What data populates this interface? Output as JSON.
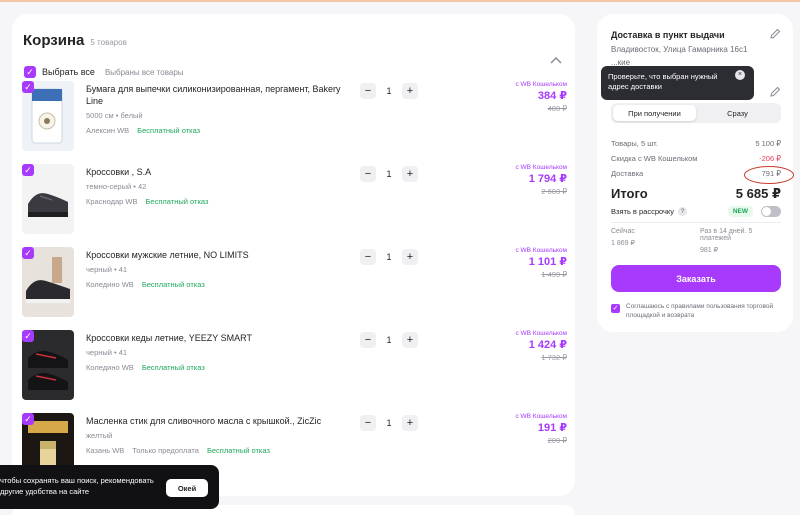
{
  "cart": {
    "title": "Корзина",
    "count": "5 товаров",
    "select_all": "Выбрать все",
    "select_all_extra": "Выбраны все товары",
    "check_glyph": "✓",
    "items": [
      {
        "name": "Бумага для выпечки силиконизированная, пергамент, Bakery Line",
        "attrs": "5000 см • белый",
        "seller": "Алексин WB",
        "return_note": "Бесплатный отказ",
        "prepay_note": "",
        "minus": "−",
        "qty": "1",
        "plus": "+",
        "wallet": "с WB Кошельком",
        "price": "384 ₽",
        "old_price": "480 ₽"
      },
      {
        "name": "Кроссовки , S.A",
        "attrs": "темно-серый • 42",
        "seller": "Краснодар WB",
        "return_note": "Бесплатный отказ",
        "prepay_note": "",
        "minus": "−",
        "qty": "1",
        "plus": "+",
        "wallet": "с WB Кошельком",
        "price": "1 794 ₽",
        "old_price": "2 603 ₽"
      },
      {
        "name": "Кроссовки мужские летние, NO LIMITS",
        "attrs": "черный • 41",
        "seller": "Коледино WB",
        "return_note": "Бесплатный отказ",
        "prepay_note": "",
        "minus": "−",
        "qty": "1",
        "plus": "+",
        "wallet": "с WB Кошельком",
        "price": "1 101 ₽",
        "old_price": "1 499 ₽"
      },
      {
        "name": "Кроссовки кеды летние, YEEZY SMART",
        "attrs": "черный • 41",
        "seller": "Коледино WB",
        "return_note": "Бесплатный отказ",
        "prepay_note": "",
        "minus": "−",
        "qty": "1",
        "plus": "+",
        "wallet": "с WB Кошельком",
        "price": "1 424 ₽",
        "old_price": "1 732 ₽"
      },
      {
        "name": "Масленка стик для сливочного масла с крышкой., ZicZic",
        "attrs": "желтый",
        "seller": "Казань WB",
        "return_note": "Бесплатный отказ",
        "prepay_note": "Только предоплата",
        "minus": "−",
        "qty": "1",
        "plus": "+",
        "wallet": "с WB Кошельком",
        "price": "191 ₽",
        "old_price": "209 ₽"
      }
    ]
  },
  "delivery": {
    "title": "Доставка в пункт выдачи",
    "address": "Владивосток, Улица Гамарника 16с1",
    "address_cut": "...кие"
  },
  "tooltip": {
    "text": "Проверьте, что выбран нужный адрес доставки",
    "close": "×"
  },
  "payment": {
    "tabs": [
      "При получении",
      "Сразу"
    ],
    "active_tab": 0
  },
  "summary": {
    "goods_label": "Товары, 5 шт.",
    "goods_value": "5 100 ₽",
    "discount_label": "Скидка с WB Кошельком",
    "discount_value": "-206 ₽",
    "delivery_label": "Доставка",
    "delivery_value": "791 ₽",
    "total_label": "Итого",
    "total_value": "5 685 ₽",
    "install_label": "Взять в рассрочку",
    "install_help": "?",
    "new_badge": "NEW",
    "now_label": "Сейчас",
    "now_value": "1 869 ₽",
    "later_label": "Раз в 14 дней. 5 платежей",
    "later_value": "981 ₽"
  },
  "order_button": "Заказать",
  "agreement": "Соглашаюсь с правилами пользования торговой площадкой и возврата",
  "cookie": {
    "text": "чтобы сохранять ваш поиск, рекомендовать другие удобства на сайте",
    "ok": "Окей"
  },
  "colors": {
    "accent": "#a73afd",
    "green": "#1fa85a",
    "discount": "#e63c5a",
    "annotation": "#c83a2a"
  }
}
